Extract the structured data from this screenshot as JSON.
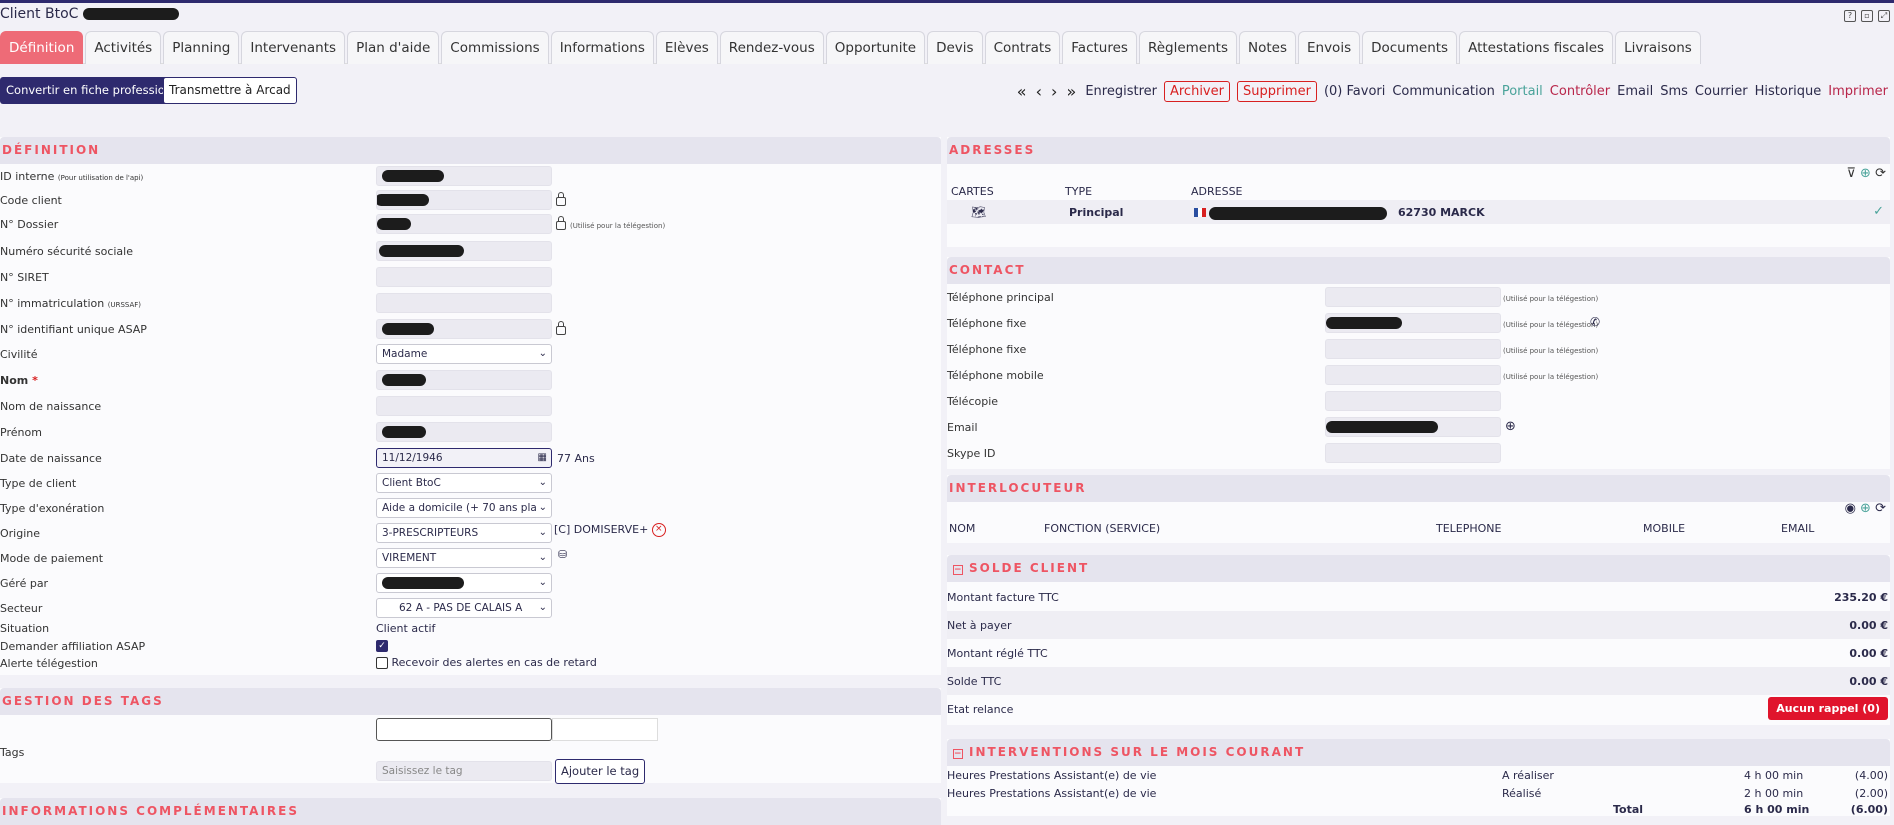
{
  "window": {
    "title": "Client BtoC"
  },
  "tabs": [
    "Définition",
    "Activités",
    "Planning",
    "Intervenants",
    "Plan d'aide",
    "Commissions",
    "Informations",
    "Elèves",
    "Rendez-vous",
    "Opportunite",
    "Devis",
    "Contrats",
    "Factures",
    "Règlements",
    "Notes",
    "Envois",
    "Documents",
    "Attestations fiscales",
    "Livraisons"
  ],
  "actions": {
    "convert": "Convertir en fiche professionnel",
    "transmit": "Transmettre à Arcad",
    "nav": "« ‹ › »",
    "save": "Enregistrer",
    "archive": "Archiver",
    "delete": "Supprimer",
    "favori": "(0) Favori",
    "communication": "Communication",
    "portail": "Portail",
    "controler": "Contrôler",
    "email": "Email",
    "sms": "Sms",
    "courrier": "Courrier",
    "historique": "Historique",
    "imprimer": "Imprimer"
  },
  "definition": {
    "title": "DÉFINITION",
    "id_interne": "ID interne",
    "id_interne_hint": "(Pour utilisation de l'api)",
    "code_client": "Code client",
    "dossier": "N° Dossier",
    "dossier_hint": "(Utilisé pour la télégestion)",
    "secu": "Numéro sécurité sociale",
    "siret": "N° SIRET",
    "immat": "N° immatriculation",
    "immat_hint": "(URSSAF)",
    "asap": "N° identifiant unique ASAP",
    "civilite": "Civilité",
    "civilite_val": "Madame",
    "nom": "Nom",
    "required": "*",
    "nom_naissance": "Nom de naissance",
    "prenom": "Prénom",
    "date_naissance": "Date de naissance",
    "date_val": "11/12/1946",
    "age": "77 Ans",
    "type_client": "Type de client",
    "type_client_val": "Client BtoC",
    "type_exo": "Type d'exonération",
    "type_exo_val": "Aide a domicile (+ 70 ans pla",
    "origine": "Origine",
    "origine_val": "3-PRESCRIPTEURS",
    "origine_extra": "[C] DOMISERVE+",
    "paiement": "Mode de paiement",
    "paiement_val": "VIREMENT",
    "gere": "Géré par",
    "secteur": "Secteur",
    "secteur_val": "62 A - PAS DE CALAIS A",
    "situation": "Situation",
    "situation_val": "Client actif",
    "affiliation": "Demander affiliation ASAP",
    "alerte": "Alerte télégestion",
    "alerte_val": "Recevoir des alertes en cas de retard"
  },
  "tags": {
    "title": "GESTION DES TAGS",
    "label": "Tags",
    "placeholder": "Saisissez le tag",
    "add": "Ajouter le tag"
  },
  "infos": {
    "title": "INFORMATIONS COMPLÉMENTAIRES"
  },
  "adresses": {
    "title": "ADRESSES",
    "cols": [
      "CARTES",
      "TYPE",
      "ADRESSE"
    ],
    "type": "Principal",
    "city": "62730 MARCK"
  },
  "contact": {
    "title": "CONTACT",
    "hint": "(Utilisé pour la télégestion)",
    "rows": [
      "Téléphone principal",
      "Téléphone fixe",
      "Téléphone fixe",
      "Téléphone mobile",
      "Télécopie",
      "Email",
      "Skype ID"
    ]
  },
  "interlocuteur": {
    "title": "INTERLOCUTEUR",
    "cols": [
      "NOM",
      "FONCTION (SERVICE)",
      "TELEPHONE",
      "MOBILE",
      "EMAIL"
    ]
  },
  "solde": {
    "title": "SOLDE CLIENT",
    "rows": [
      {
        "label": "Montant facture TTC",
        "value": "235.20 €"
      },
      {
        "label": "Net à payer",
        "value": "0.00 €"
      },
      {
        "label": "Montant réglé TTC",
        "value": "0.00 €"
      },
      {
        "label": "Solde TTC",
        "value": "0.00 €"
      }
    ],
    "relance": "Etat relance",
    "relance_btn": "Aucun rappel (0)"
  },
  "interventions": {
    "title": "INTERVENTIONS SUR LE MOIS COURANT",
    "rows": [
      {
        "label": "Heures Prestations Assistant(e) de vie",
        "status": "A réaliser",
        "time": "4 h 00 min",
        "count": "(4.00)"
      },
      {
        "label": "Heures Prestations Assistant(e) de vie",
        "status": "Réalisé",
        "time": "2 h 00 min",
        "count": "(2.00)"
      }
    ],
    "total_label": "Total",
    "total_time": "6 h 00 min",
    "total_count": "(6.00)"
  }
}
